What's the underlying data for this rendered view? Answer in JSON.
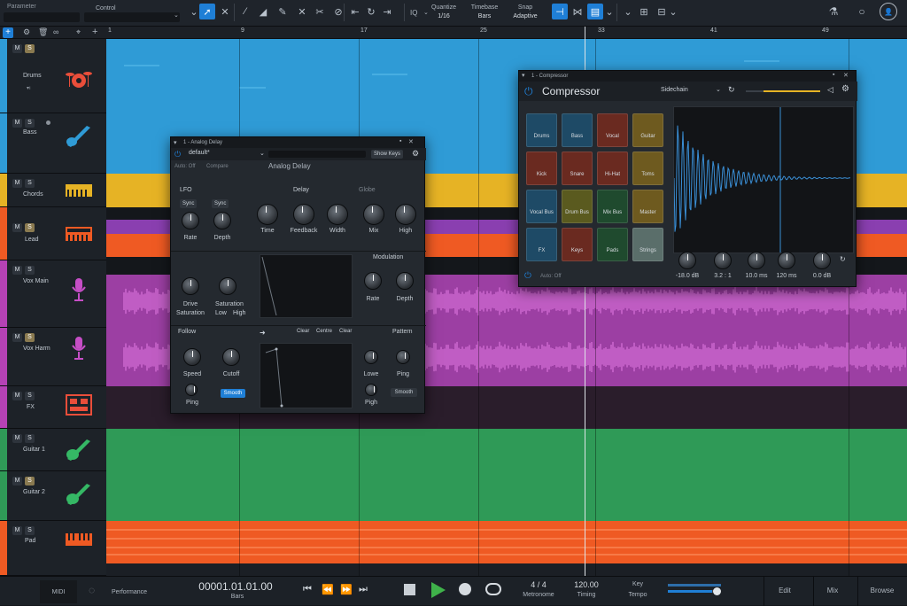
{
  "toolbar": {
    "parameter_label": "Parameter",
    "control_label": "Control",
    "quantize_label": "Quantize",
    "quantize_value": "1/16",
    "timebase_label": "Timebase",
    "timebase_value": "Bars",
    "snap_label": "Snap",
    "snap_value": "Adaptive",
    "iq_label": "IQ"
  },
  "ruler": {
    "marks": [
      "1",
      "9",
      "17",
      "25",
      "33",
      "41",
      "49"
    ]
  },
  "tracks": [
    {
      "name": "Drums",
      "color": "#2f9bd6",
      "icon": "drum-kit-icon",
      "m": "M",
      "s": "S",
      "solo_on": true
    },
    {
      "name": "Bass",
      "color": "#2f9bd6",
      "icon": "bass-guitar-icon",
      "m": "M",
      "s": "S",
      "solo_on": false
    },
    {
      "name": "Chords",
      "color": "#e6b325",
      "icon": "keyboard-icon",
      "m": "M",
      "s": "S",
      "solo_on": false
    },
    {
      "name": "Lead",
      "color": "#ef5a23",
      "icon": "synth-keyboard-icon",
      "m": "M",
      "s": "S",
      "solo_on": true
    },
    {
      "name": "Vox Main",
      "color": "#b542b5",
      "icon": "microphone-icon",
      "m": "M",
      "s": "S",
      "solo_on": false
    },
    {
      "name": "Vox Harm",
      "color": "#b542b5",
      "icon": "microphone-icon",
      "m": "M",
      "s": "S",
      "solo_on": true
    },
    {
      "name": "FX",
      "color": "#b542b5",
      "icon": "fx-rack-icon",
      "m": "M",
      "s": "S",
      "solo_on": false
    },
    {
      "name": "Guitar 1",
      "color": "#2f9a57",
      "icon": "guitar-icon",
      "m": "M",
      "s": "S",
      "solo_on": false
    },
    {
      "name": "Guitar 2",
      "color": "#2f9a57",
      "icon": "guitar-icon",
      "m": "M",
      "s": "S",
      "solo_on": true
    },
    {
      "name": "Pad",
      "color": "#ef5a23",
      "icon": "piano-icon",
      "m": "M",
      "s": "S",
      "solo_on": false
    }
  ],
  "delay": {
    "title": "Analog Delay",
    "header_title": "1 - Analog Delay",
    "preset": "default*",
    "show_keys": "Show Keys",
    "plugin_name": "Analog Delay",
    "auto_off": "Auto: Off",
    "compare": "Compare",
    "sections": {
      "lfo": "LFO",
      "delay": "Delay",
      "globe": "Globe",
      "modulation": "Modulation",
      "follow": "Follow",
      "pattern": "Pattern"
    },
    "lfo_knobs": [
      {
        "label": "Rate"
      },
      {
        "label": "Depth"
      }
    ],
    "lfo_sync": [
      "Sync",
      "Sync"
    ],
    "delay_knobs": [
      {
        "label": "Time"
      },
      {
        "label": "Feedback"
      },
      {
        "label": "Width"
      },
      {
        "label": "Mix"
      },
      {
        "label": "High"
      }
    ],
    "mid_knobs": [
      {
        "label": "Drive"
      },
      {
        "label": "Saturation"
      }
    ],
    "mid_labels": {
      "saturation": "Saturation",
      "low": "Low",
      "high": "High"
    },
    "mod_knobs": [
      {
        "label": "Rate"
      },
      {
        "label": "Depth"
      }
    ],
    "bot_knobs": [
      {
        "label": "Speed"
      },
      {
        "label": "Cutoff"
      },
      {
        "label": "Lowe"
      },
      {
        "label": "Ping"
      }
    ],
    "bot_small": [
      "Ping",
      "Pigh"
    ],
    "smooth": "Smooth",
    "smooth2": "Smooth",
    "filter_tabs": [
      "Clear",
      "Centre",
      "Clear"
    ]
  },
  "compressor": {
    "header_title": "1 - Compressor",
    "title": "Compressor",
    "sidechain": "Sidechain",
    "auto_off": "Auto: Off",
    "pads": [
      {
        "label": "Drums",
        "color": "#1e4a66"
      },
      {
        "label": "Bass",
        "color": "#1e4a66"
      },
      {
        "label": "Vocal",
        "color": "#6a2a20"
      },
      {
        "label": "Guitar",
        "color": "#6e5a1f"
      },
      {
        "label": "Kick",
        "color": "#6a2a20"
      },
      {
        "label": "Snare",
        "color": "#6a2a20"
      },
      {
        "label": "Hi-Hat",
        "color": "#6a2a20"
      },
      {
        "label": "Toms",
        "color": "#6e5a1f"
      },
      {
        "label": "Vocal Bus",
        "color": "#1e4a66"
      },
      {
        "label": "Drum Bus",
        "color": "#5a5a1f"
      },
      {
        "label": "Mix Bus",
        "color": "#1f4a2e"
      },
      {
        "label": "Master",
        "color": "#6e5a1f"
      },
      {
        "label": "FX",
        "color": "#1e4a66"
      },
      {
        "label": "Keys",
        "color": "#6a2a20"
      },
      {
        "label": "Pads",
        "color": "#1f4a2e"
      },
      {
        "label": "Strings",
        "color": "#5a6e6a"
      }
    ],
    "knobs": [
      "-18.0 dB",
      "3.2 : 1",
      "10.0 ms",
      "120 ms",
      "0.0 dB"
    ]
  },
  "transport": {
    "midi": "MIDI",
    "performance": "Performance",
    "position": "00001.01.01.00",
    "position_unit": "Bars",
    "signature": "4 / 4",
    "metronome": "Metronome",
    "tempo_value": "120.00",
    "timing": "Timing",
    "key": "Key",
    "tempo": "Tempo",
    "edit": "Edit",
    "mix": "Mix",
    "browse": "Browse"
  },
  "colors": {
    "accent": "#1f7fd6",
    "blue_track": "#2f9bd6",
    "yellow_track": "#e6b325",
    "orange_track": "#ef5a23",
    "purple_track": "#b542b5",
    "green_track": "#2f9a57"
  }
}
